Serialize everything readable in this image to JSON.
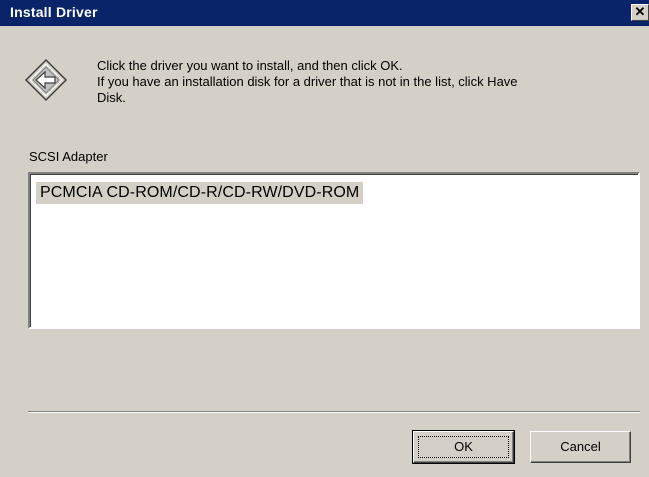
{
  "window": {
    "title": "Install Driver",
    "close_glyph": "✕"
  },
  "instructions": {
    "line1": "Click the driver you want to install, and then click OK.",
    "line2": "If you have an installation disk for a driver that is not in the list, click Have",
    "line3": "Disk."
  },
  "list": {
    "label": "SCSI Adapter",
    "items": [
      {
        "label": "PCMCIA CD-ROM/CD-R/CD-RW/DVD-ROM",
        "selected": true
      }
    ]
  },
  "buttons": {
    "ok_label": "OK",
    "cancel_label": "Cancel"
  },
  "icons": {
    "driver": "driver-install-icon",
    "close": "close-icon"
  },
  "colors": {
    "titlebar": "#0a246a",
    "face": "#d4d0c8",
    "selection": "#d4d0c8"
  }
}
